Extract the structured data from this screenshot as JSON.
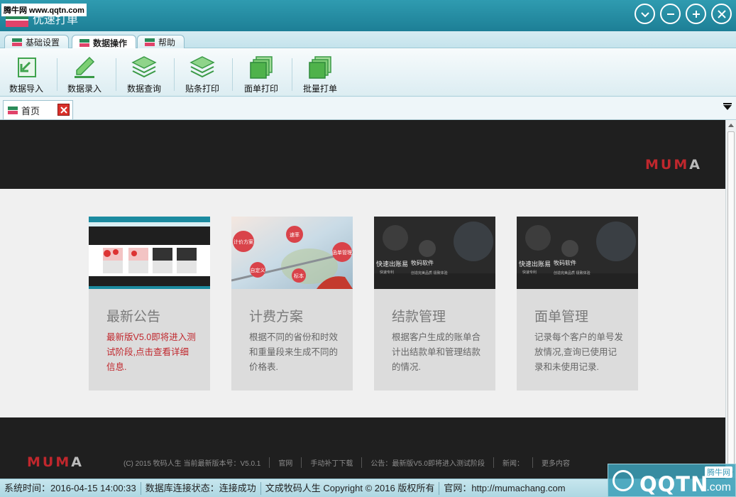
{
  "watermark_top": "腾牛网 www.qqtn.com",
  "window": {
    "title": "优速打单"
  },
  "ribbon_tabs": [
    {
      "label": "基础设置"
    },
    {
      "label": "数据操作"
    },
    {
      "label": "帮助"
    }
  ],
  "toolbar": [
    {
      "label": "数据导入",
      "icon": "import-icon"
    },
    {
      "label": "数据录入",
      "icon": "pencil-icon"
    },
    {
      "label": "数据查询",
      "icon": "stack-icon"
    },
    {
      "label": "贴条打印",
      "icon": "stack-icon"
    },
    {
      "label": "面单打印",
      "icon": "sheets-icon"
    },
    {
      "label": "批量打单",
      "icon": "sheets-icon"
    }
  ],
  "doc_tab": {
    "label": "首页"
  },
  "brand": "MUMA",
  "cards": [
    {
      "title": "最新公告",
      "desc": "最新版V5.0即将进入测试阶段,点击查看详细信息."
    },
    {
      "title": "计费方案",
      "desc": "根据不同的省份和时效和重量段来生成不同的价格表."
    },
    {
      "title": "结款管理",
      "desc": "根据客户生成的账单合计出结款单和管理结款的情况."
    },
    {
      "title": "面单管理",
      "desc": "记录每个客户的单号发放情况,查询已使用记录和未使用记录."
    }
  ],
  "thumbs": {
    "bubble_words": [
      "计价方案",
      "速率",
      "函单管理",
      "自定义",
      "标本"
    ],
    "dark_left": "快速出账易",
    "dark_left_sub": "快速专利",
    "dark_right": "牧码软件",
    "dark_right_sub": "创造完美品质 极致体验"
  },
  "footer": {
    "items": [
      "(C) 2015 牧码人生 当前最新版本号：V5.0.1",
      "官网",
      "手动补丁下载",
      "公告：最新版V5.0即将进入测试阶段",
      "新闻：",
      "更多内容"
    ]
  },
  "status": {
    "time": "系统时间：2016-04-15 14:00:33",
    "db": "数据库连接状态：连接成功",
    "copyright": "文成牧码人生 Copyright © 2016 版权所有",
    "site": "官网：http://mumachang.com"
  },
  "watermark_corner": {
    "small": "腾牛网",
    "big": "QQTN",
    "suffix": ".com"
  },
  "colors": {
    "brand_red": "#c0272d",
    "title_bar": "#1d7f96",
    "accent_green": "#2a8a58"
  }
}
